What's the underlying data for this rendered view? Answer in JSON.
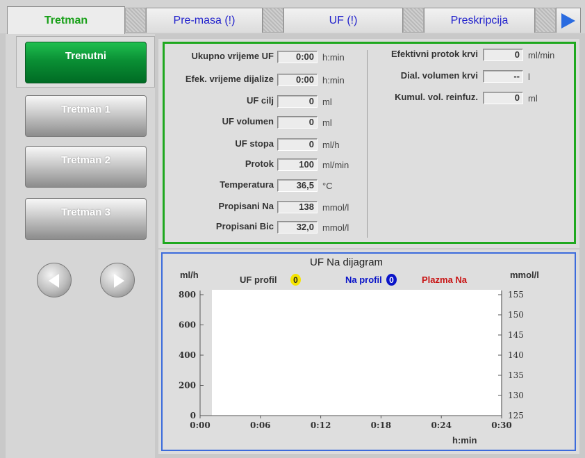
{
  "tabs": [
    {
      "label": "Tretman",
      "active": true
    },
    {
      "label": "Pre-masa (!)",
      "active": false
    },
    {
      "label": "UF (!)",
      "active": false
    },
    {
      "label": "Preskripcija",
      "active": false
    }
  ],
  "treatments": [
    {
      "label": "Trenutni",
      "active": true
    },
    {
      "label": "Tretman 1",
      "active": false
    },
    {
      "label": "Tretman 2",
      "active": false
    },
    {
      "label": "Tretman 3",
      "active": false
    }
  ],
  "params_left": [
    {
      "label": "Ukupno vrijeme UF",
      "value": "0:00",
      "unit": "h:min"
    },
    {
      "label": "Efek. vrijeme dijalize",
      "value": "0:00",
      "unit": "h:min"
    },
    {
      "label": "UF cilj",
      "value": "0",
      "unit": "ml"
    },
    {
      "label": "UF volumen",
      "value": "0",
      "unit": "ml"
    },
    {
      "label": "UF stopa",
      "value": "0",
      "unit": "ml/h"
    },
    {
      "label": "Protok",
      "value": "100",
      "unit": "ml/min"
    },
    {
      "label": "Temperatura",
      "value": "36,5",
      "unit": "°C"
    },
    {
      "label": "Propisani Na",
      "value": "138",
      "unit": "mmol/l"
    },
    {
      "label": "Propisani Bic",
      "value": "32,0",
      "unit": "mmol/l"
    }
  ],
  "params_right": [
    {
      "label": "Efektivni protok krvi",
      "value": "0",
      "unit": "ml/min"
    },
    {
      "label": "Dial. volumen krvi",
      "value": "--",
      "unit": "l"
    },
    {
      "label": "Kumul. vol. reinfuz.",
      "value": "0",
      "unit": "ml"
    }
  ],
  "chart": {
    "title": "UF Na dijagram",
    "left_unit": "ml/h",
    "right_unit": "mmol/l",
    "x_unit": "h:min",
    "legend": {
      "uf_profile": "UF profil",
      "uf_badge": "0",
      "na_profile": "Na profil",
      "na_badge": "0",
      "plasma_na": "Plazma Na"
    },
    "colors": {
      "uf": "#f5e400",
      "na": "#0a14c8",
      "plasma": "#c81414",
      "frame": "#3b6bdc",
      "params_frame": "#1ea81e"
    }
  },
  "chart_data": {
    "type": "line",
    "title": "UF Na dijagram",
    "xlabel": "h:min",
    "ylabel": "ml/h",
    "y2label": "mmol/l",
    "x_ticks": [
      "0:00",
      "0:06",
      "0:12",
      "0:18",
      "0:24",
      "0:30"
    ],
    "y_ticks": [
      0,
      200,
      400,
      600,
      800
    ],
    "y2_ticks": [
      125,
      130,
      135,
      140,
      145,
      150,
      155
    ],
    "ylim": [
      0,
      800
    ],
    "y2lim": [
      125,
      155
    ],
    "series": [
      {
        "name": "UF profil",
        "values": []
      },
      {
        "name": "Na profil",
        "values": []
      },
      {
        "name": "Plazma Na",
        "values": []
      }
    ]
  }
}
